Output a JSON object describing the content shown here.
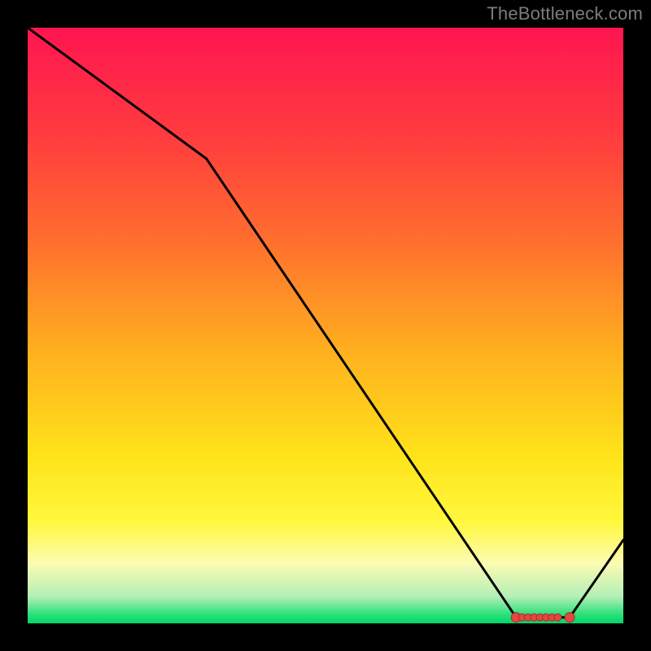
{
  "attribution": "TheBottleneck.com",
  "colors": {
    "bg": "#000000",
    "attribution_text": "#7c7c7c",
    "line": "#000000",
    "marker_fill": "#e2483f",
    "marker_stroke": "#a92c27"
  },
  "chart_data": {
    "type": "line",
    "title": "",
    "xlabel": "",
    "ylabel": "",
    "xlim": [
      0,
      100
    ],
    "ylim": [
      0,
      100
    ],
    "x": [
      0,
      30,
      82,
      91,
      100
    ],
    "y": [
      100,
      78,
      1,
      1,
      14
    ],
    "markers": {
      "x": [
        82,
        83,
        84,
        85,
        86,
        87,
        88,
        89,
        91
      ],
      "y": [
        1,
        1,
        1,
        1,
        1,
        1,
        1,
        1,
        1
      ]
    },
    "background_gradient_stops": [
      {
        "offset": 0.0,
        "color": "#ff1550"
      },
      {
        "offset": 0.18,
        "color": "#ff3b3f"
      },
      {
        "offset": 0.36,
        "color": "#ff6f2e"
      },
      {
        "offset": 0.55,
        "color": "#ffb21e"
      },
      {
        "offset": 0.72,
        "color": "#ffe31a"
      },
      {
        "offset": 0.83,
        "color": "#fff83e"
      },
      {
        "offset": 0.9,
        "color": "#fbfbb4"
      },
      {
        "offset": 0.955,
        "color": "#b3efb6"
      },
      {
        "offset": 0.985,
        "color": "#2de07a"
      },
      {
        "offset": 1.0,
        "color": "#00d76a"
      }
    ]
  }
}
